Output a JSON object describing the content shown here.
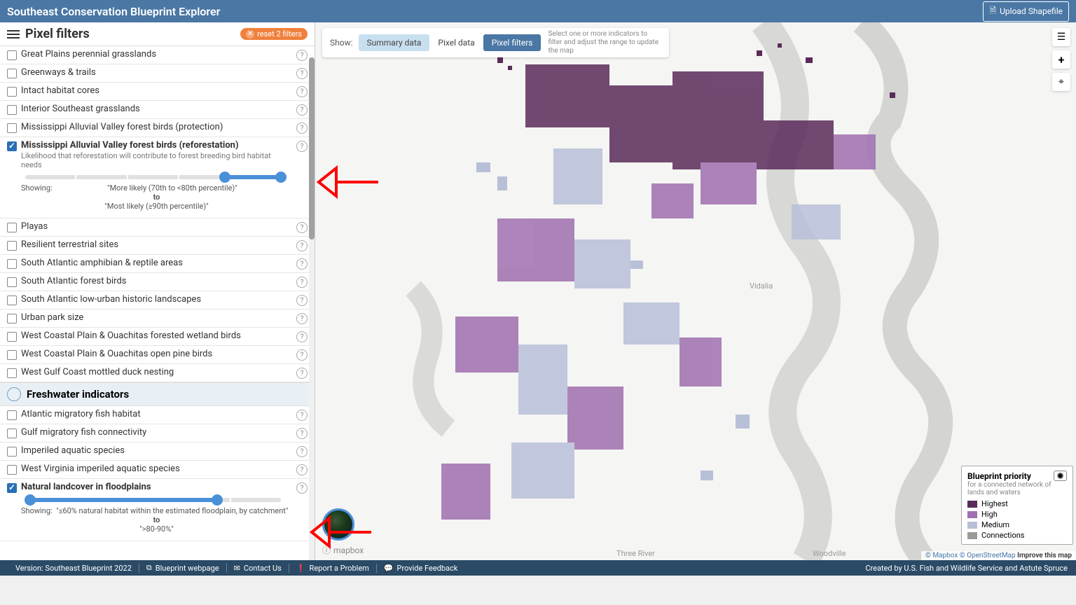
{
  "header": {
    "title": "Southeast  Conservation Blueprint Explorer",
    "upload": "Upload Shapefile"
  },
  "sidebar": {
    "title": "Pixel filters",
    "reset": "reset 2 filters"
  },
  "indicators": {
    "land": [
      {
        "label": "Great Plains perennial grasslands",
        "checked": false
      },
      {
        "label": "Greenways & trails",
        "checked": false
      },
      {
        "label": "Intact habitat cores",
        "checked": false
      },
      {
        "label": "Interior Southeast grasslands",
        "checked": false
      },
      {
        "label": "Mississippi Alluvial Valley forest birds (protection)",
        "checked": false
      },
      {
        "label": "Mississippi Alluvial Valley forest birds (reforestation)",
        "checked": true,
        "desc": "Likelihood that reforestation will contribute to forest breeding bird habitat needs",
        "showing_from": "\"More likely (70th to <80th percentile)\"",
        "to": "to",
        "showing_to": "\"Most likely (≥90th percentile)\""
      },
      {
        "label": "Playas",
        "checked": false
      },
      {
        "label": "Resilient terrestrial sites",
        "checked": false
      },
      {
        "label": "South Atlantic amphibian & reptile areas",
        "checked": false
      },
      {
        "label": "South Atlantic forest birds",
        "checked": false
      },
      {
        "label": "South Atlantic low-urban historic landscapes",
        "checked": false
      },
      {
        "label": "Urban park size",
        "checked": false
      },
      {
        "label": "West Coastal Plain & Ouachitas forested wetland birds",
        "checked": false
      },
      {
        "label": "West Coastal Plain & Ouachitas open pine birds",
        "checked": false
      },
      {
        "label": "West Gulf Coast mottled duck nesting",
        "checked": false
      }
    ],
    "freshwaterTitle": "Freshwater indicators",
    "freshwater": [
      {
        "label": "Atlantic migratory fish habitat",
        "checked": false
      },
      {
        "label": "Gulf migratory fish connectivity",
        "checked": false
      },
      {
        "label": "Imperiled aquatic species",
        "checked": false
      },
      {
        "label": "West Virginia imperiled aquatic species",
        "checked": false
      },
      {
        "label": "Natural landcover in floodplains",
        "checked": true,
        "showing_from": "\"≤60% natural habitat within the estimated floodplain, by catchment\"",
        "to": "to",
        "showing_to": "\">80-90%\""
      }
    ]
  },
  "showing_label": "Showing:",
  "toolbar": {
    "show": "Show:",
    "summary": "Summary data",
    "pixel": "Pixel data",
    "filters": "Pixel filters",
    "help": "Select one or more indicators to filter and adjust the range to update the map"
  },
  "legend": {
    "title": "Blueprint priority",
    "sub": "for a connected network of lands and waters",
    "items": [
      {
        "color": "#5a2a5a",
        "label": "Highest"
      },
      {
        "color": "#a070b0",
        "label": "High"
      },
      {
        "color": "#b8c0d8",
        "label": "Medium"
      },
      {
        "color": "#9a9a9a",
        "label": "Connections"
      }
    ]
  },
  "map": {
    "labels": {
      "vidalia": "Vidalia",
      "threeriv": "Three River",
      "woodville": "Woodville"
    },
    "attr": {
      "mapbox": "© Mapbox",
      "osm": "© OpenStreetMap",
      "improve": "Improve this map"
    },
    "logo": "mapbox"
  },
  "footer": {
    "version": "Version: Southeast Blueprint 2022",
    "webpage": "Blueprint webpage",
    "contact": "Contact Us",
    "report": "Report a Problem",
    "feedback": "Provide Feedback",
    "credit": "Created by U.S. Fish and Wildlife Service and Astute Spruce"
  }
}
